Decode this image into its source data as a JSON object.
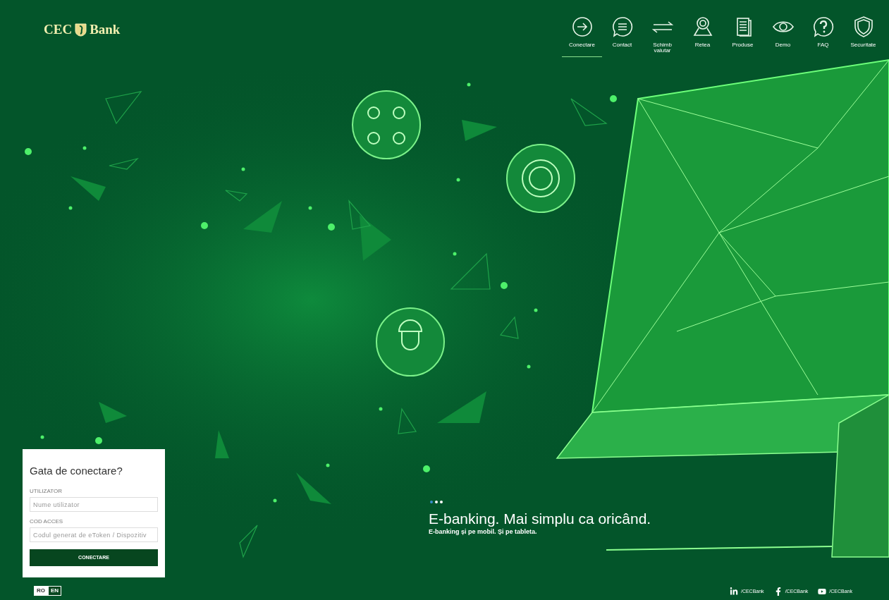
{
  "logo": {
    "left": "CEC",
    "right": "Bank"
  },
  "nav": [
    {
      "label": "Conectare",
      "kind": "login",
      "selected": true
    },
    {
      "label": "Contact",
      "kind": "chat",
      "selected": false
    },
    {
      "label": "Schimb valutar",
      "kind": "exchange",
      "selected": false
    },
    {
      "label": "Retea",
      "kind": "pin",
      "selected": false
    },
    {
      "label": "Produse",
      "kind": "docs",
      "selected": false
    },
    {
      "label": "Demo",
      "kind": "eye",
      "selected": false
    },
    {
      "label": "FAQ",
      "kind": "question",
      "selected": false
    },
    {
      "label": "Securitate",
      "kind": "shield",
      "selected": false
    }
  ],
  "login": {
    "title": "Gata de conectare?",
    "fields": [
      {
        "label": "UTILIZATOR",
        "placeholder": "Nume utilizator"
      },
      {
        "label": "COD ACCES",
        "placeholder": "Codul generat de eToken / Dispozitiv"
      }
    ],
    "button": "CONECTARE"
  },
  "languages": [
    {
      "label": "RO",
      "selected": false
    },
    {
      "label": "EN",
      "selected": true
    }
  ],
  "carousel": {
    "dots": [
      {
        "selected": true
      },
      {
        "selected": false
      },
      {
        "selected": false
      }
    ],
    "headline": "E-banking. Mai simplu ca oricând.",
    "subline": "E-banking și pe mobil. Și pe tableta."
  },
  "social": [
    {
      "kind": "linkedin",
      "label": "/CECBank"
    },
    {
      "kind": "facebook",
      "label": "/CECBank"
    },
    {
      "kind": "youtube",
      "label": "/CECBank"
    }
  ]
}
